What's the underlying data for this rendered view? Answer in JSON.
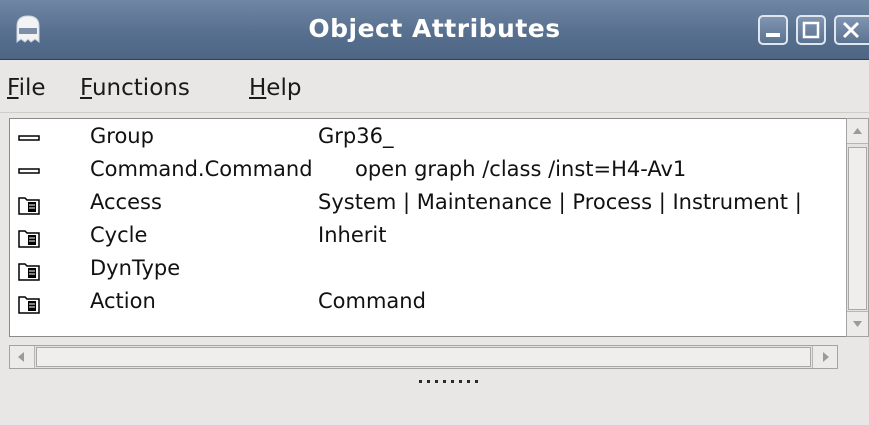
{
  "window": {
    "title": "Object Attributes",
    "icons": {
      "app": "ghost-app-icon",
      "minimize": "minimize-icon",
      "maximize": "maximize-icon",
      "close": "close-icon"
    }
  },
  "menu": {
    "file": {
      "key": "F",
      "rest": "ile"
    },
    "functions": {
      "key": "F",
      "rest": "unctions"
    },
    "help": {
      "key": "H",
      "rest": "elp"
    }
  },
  "attributes": [
    {
      "icon": "attribute-line-icon",
      "name": "Group",
      "value": "Grp36_"
    },
    {
      "icon": "attribute-line-icon",
      "name": "Command.Command",
      "value": "open graph /class /inst=H4-Av1"
    },
    {
      "icon": "folder-icon",
      "name": "Access",
      "value": "System | Maintenance | Process | Instrument |"
    },
    {
      "icon": "folder-icon",
      "name": "Cycle",
      "value": "Inherit"
    },
    {
      "icon": "folder-icon",
      "name": "DynType",
      "value": ""
    },
    {
      "icon": "folder-icon",
      "name": "Action",
      "value": "Command"
    }
  ],
  "colors": {
    "titlebar": "#58708f",
    "background": "#e8e7e5",
    "list_bg": "#ffffff"
  }
}
